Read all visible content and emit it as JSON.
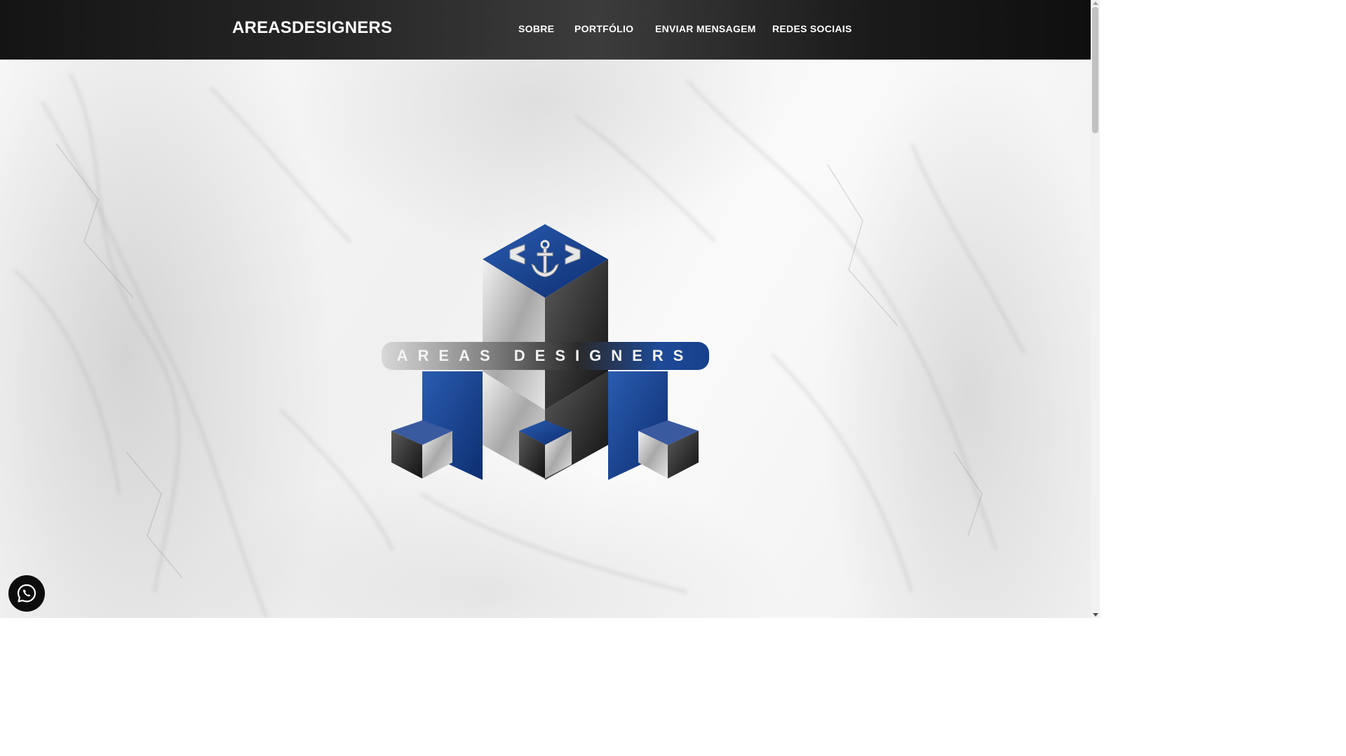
{
  "header": {
    "brand": "AREASDESIGNERS",
    "nav": [
      "SOBRE",
      "PORTFÓLIO",
      "ENVIAR MENSAGEM",
      "REDES SOCIAIS"
    ]
  },
  "hero": {
    "logo_text": "AREAS DESIGNERS",
    "logo_icon": "anchor-icon",
    "logo_alt": "Areas Designers logo"
  },
  "floating": {
    "whatsapp_icon": "whatsapp-icon",
    "whatsapp_label": "WhatsApp"
  },
  "colors": {
    "header_bg": "#1f1f1f",
    "accent_blue": "#1a4a9a",
    "text_white": "#ffffff",
    "background": "#f4f4f4"
  }
}
